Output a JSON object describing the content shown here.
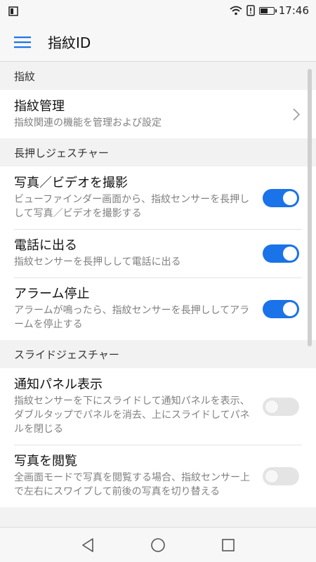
{
  "status_bar": {
    "time": "17:46",
    "battery_level": 0.6
  },
  "header": {
    "title": "指紋ID",
    "menu_icon": "hamburger-menu-icon"
  },
  "sections": [
    {
      "title": "指紋",
      "items": [
        {
          "title": "指紋管理",
          "description": "指紋関連の機能を管理および設定",
          "control": "chevron"
        }
      ]
    },
    {
      "title": "長押しジェスチャー",
      "items": [
        {
          "title": "写真／ビデオを撮影",
          "description": "ビューファインダー画面から、指紋センサーを長押しして写真／ビデオを撮影する",
          "control": "toggle",
          "enabled": true
        },
        {
          "title": "電話に出る",
          "description": "指紋センサーを長押しして電話に出る",
          "control": "toggle",
          "enabled": true
        },
        {
          "title": "アラーム停止",
          "description": "アラームが鳴ったら、指紋センサーを長押ししてアラームを停止する",
          "control": "toggle",
          "enabled": true
        }
      ]
    },
    {
      "title": "スライドジェスチャー",
      "items": [
        {
          "title": "通知パネル表示",
          "description": "指紋センサーを下にスライドして通知パネルを表示、ダブルタップでパネルを消去、上にスライドしてパネルを閉じる",
          "control": "toggle",
          "enabled": false
        },
        {
          "title": "写真を閲覧",
          "description": "全画面モードで写真を閲覧する場合、指紋センサー上で左右にスワイプして前後の写真を切り替える",
          "control": "toggle",
          "enabled": false
        }
      ]
    }
  ],
  "colors": {
    "accent": "#1a73e8",
    "toggle_off": "#e4e4e4",
    "text_primary": "#111111",
    "text_secondary": "#808080"
  },
  "nav_bar": {
    "back_icon": "back-triangle-icon",
    "home_icon": "home-circle-icon",
    "recents_icon": "recents-square-icon"
  }
}
